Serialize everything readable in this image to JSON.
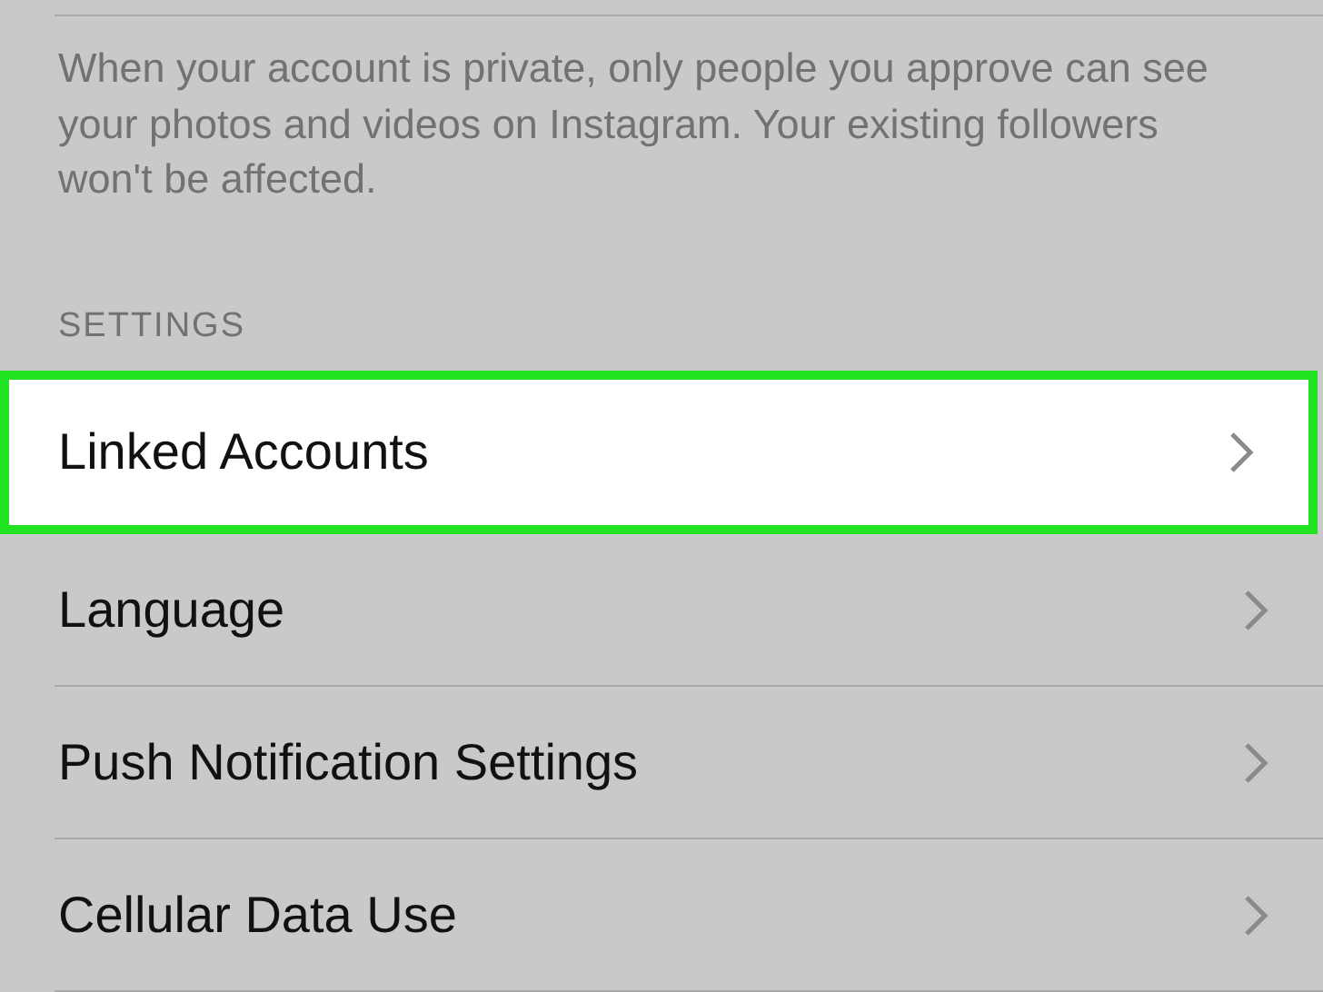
{
  "privacy_note": "When your account is private, only people you approve can see your photos and videos on Instagram. Your existing followers won't be affected.",
  "section_header": "SETTINGS",
  "rows": [
    {
      "label": "Linked Accounts",
      "selected": true
    },
    {
      "label": "Language",
      "selected": false
    },
    {
      "label": "Push Notification Settings",
      "selected": false
    },
    {
      "label": "Cellular Data Use",
      "selected": false
    }
  ]
}
